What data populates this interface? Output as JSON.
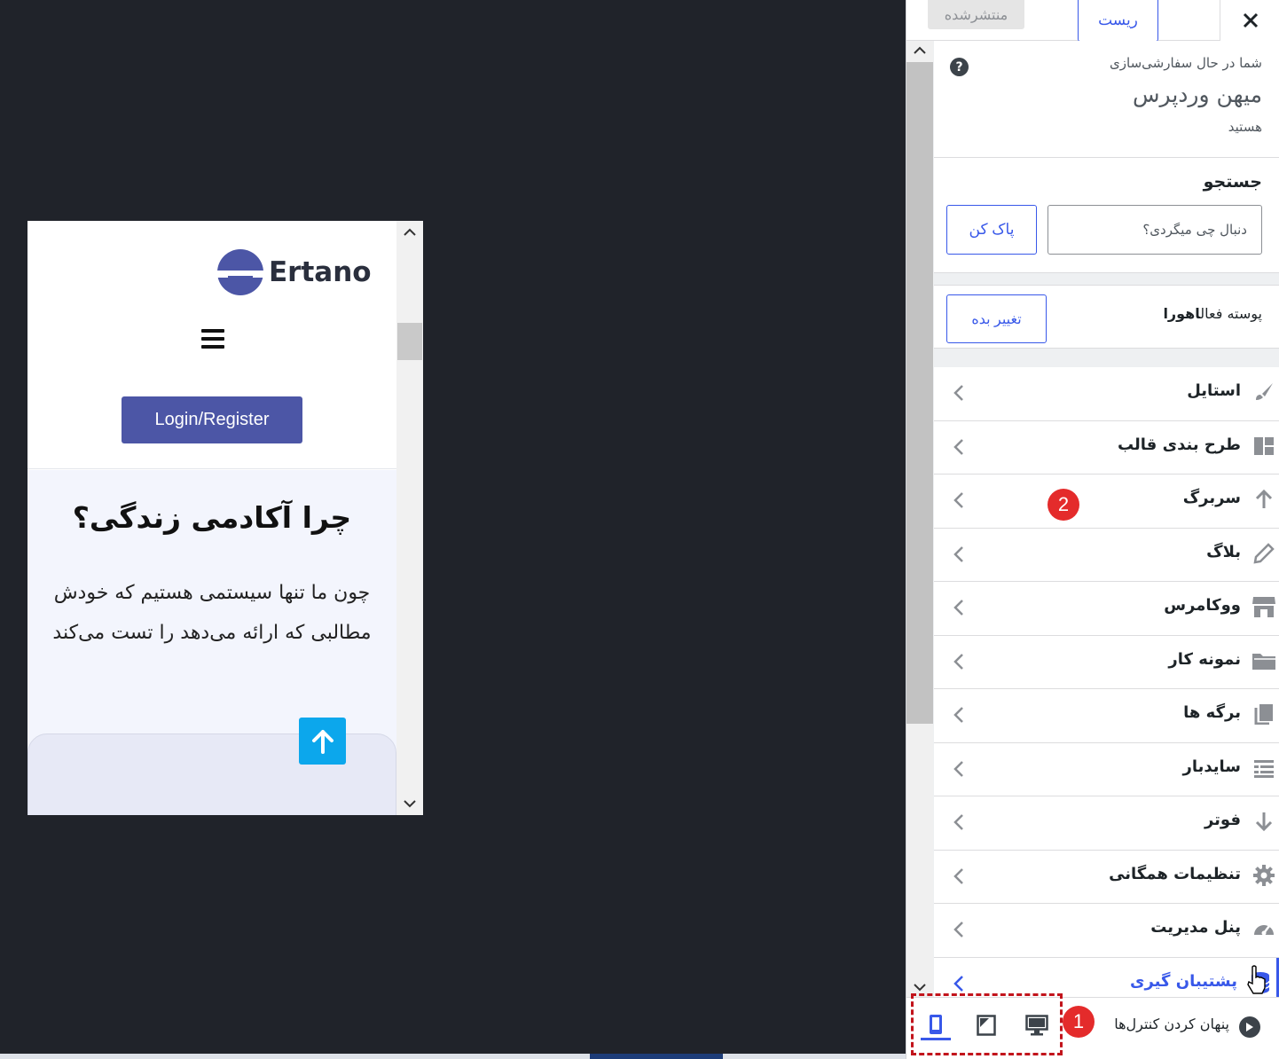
{
  "preview": {
    "logo_text": "Ertano",
    "login_button": "Login/Register",
    "hero_title": "چرا آکادمی زندگی؟",
    "hero_text": "چون ما تنها سیستمی هستیم که خودش مطالبی که ارائه می‌دهد را تست می‌کند",
    "brand_color": "#4c56a6",
    "up_button_color": "#0ca7ec"
  },
  "panel": {
    "close_icon": "close-icon",
    "reset_label": "ریست",
    "published_label": "منتشرشده",
    "info_line1": "شما در حال سفارشی‌سازی",
    "info_site": "میهن وردپرس",
    "info_line3": "هستید",
    "help_glyph": "?",
    "search": {
      "title": "جستجو",
      "placeholder": "دنبال چی میگردی؟",
      "clear_label": "پاک کن"
    },
    "theme": {
      "label": "پوسته فعال",
      "name": "اهورا",
      "change_label": "تغییر بده"
    },
    "menu": [
      {
        "label": "استایل",
        "icon": "brush-icon"
      },
      {
        "label": "طرح بندی قالب",
        "icon": "layout-icon"
      },
      {
        "label": "سربرگ",
        "icon": "arrow-up-icon"
      },
      {
        "label": "بلاگ",
        "icon": "pencil-icon"
      },
      {
        "label": "ووکامرس",
        "icon": "store-icon"
      },
      {
        "label": "نمونه کار",
        "icon": "folder-icon"
      },
      {
        "label": "برگه ها",
        "icon": "pages-icon"
      },
      {
        "label": "سایدبار",
        "icon": "sidebar-icon"
      },
      {
        "label": "فوتر",
        "icon": "arrow-down-icon"
      },
      {
        "label": "تنظیمات همگانی",
        "icon": "gear-icon"
      },
      {
        "label": "پنل مدیریت",
        "icon": "dashboard-icon"
      },
      {
        "label": "پشتیبان گیری",
        "icon": "database-icon"
      }
    ],
    "hide_controls_label": "پنهان کردن کنترل‌ها",
    "badge_1": "1",
    "badge_2": "2",
    "accent_color": "#3858e9",
    "highlight_color": "#c2141c"
  }
}
